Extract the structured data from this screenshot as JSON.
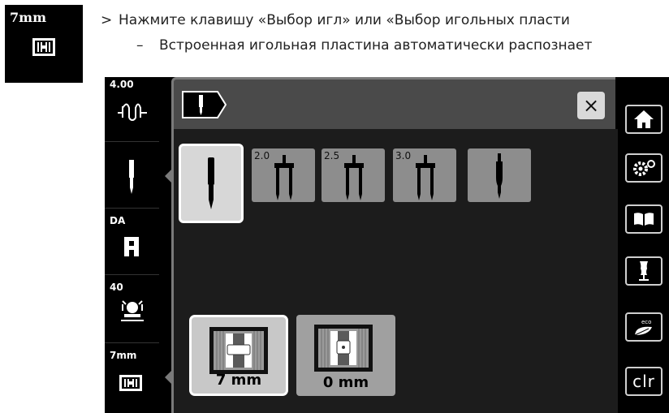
{
  "top_icon": {
    "label": "7mm"
  },
  "instructions": {
    "step_marker": ">",
    "step_text": "Нажмите клавишу «Выбор игл» или «Выбор игольных пласти",
    "note_marker": "–",
    "note_text": "Встроенная игольная пластина автоматически распознает"
  },
  "left_sidebar": {
    "thread_tension": "4.00",
    "presser_foot": "DA",
    "presser_pressure": "40",
    "stitch_plate": "7mm"
  },
  "needle_options": [
    {
      "label": "",
      "icon": "single-needle-icon",
      "selected": true
    },
    {
      "label": "2.0",
      "icon": "twin-needle-icon",
      "selected": false
    },
    {
      "label": "2.5",
      "icon": "twin-needle-icon",
      "selected": false
    },
    {
      "label": "3.0",
      "icon": "twin-needle-icon",
      "selected": false
    },
    {
      "label": "",
      "icon": "wing-needle-icon",
      "selected": false
    }
  ],
  "plate_options": [
    {
      "label": "7 mm",
      "icon": "stitch-plate-7mm-icon",
      "selected": true
    },
    {
      "label": "0 mm",
      "icon": "stitch-plate-0mm-icon",
      "selected": false
    }
  ],
  "right_sidebar": {
    "buttons": [
      "home-icon",
      "settings-icon",
      "guide-book-icon",
      "tutorial-mannequin-icon",
      "eco-icon",
      "clear-button"
    ],
    "clr_label": "clr"
  },
  "close_icon": "×",
  "colors": {
    "panel_bg": "#4a4a4a",
    "content_bg": "#1c1c1c",
    "button_gray": "#8d8d8d",
    "selected_bg": "#d7d7d7"
  }
}
